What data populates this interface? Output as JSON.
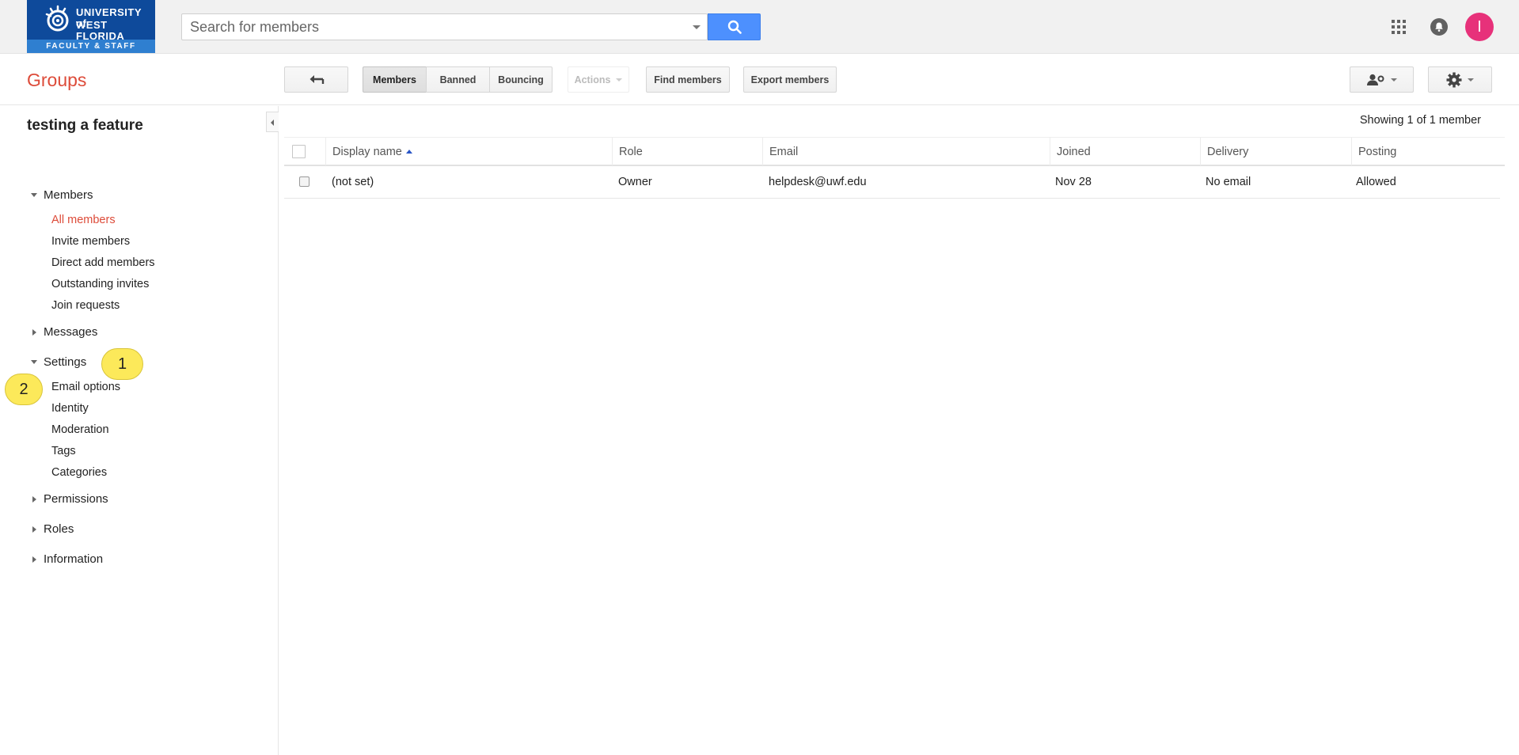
{
  "topbar": {
    "logo": {
      "line1": "UNIVERSITY of",
      "line2": "WEST FLORIDA",
      "band": "FACULTY & STAFF"
    },
    "search": {
      "placeholder": "Search for members",
      "value": ""
    },
    "icons": {
      "search": "search-icon",
      "apps": "apps-grid-icon",
      "notifications": "bell-icon"
    },
    "avatar_initial": "I",
    "avatar_color": "#e7317a"
  },
  "header": {
    "app_title": "Groups",
    "back_icon": "back-arrow-icon",
    "tabs": [
      "Members",
      "Banned",
      "Bouncing"
    ],
    "active_tab": "Members",
    "actions_label": "Actions",
    "find_members": "Find members",
    "export_members": "Export members",
    "add_member_icon": "person-gear-icon",
    "settings_icon": "gear-icon"
  },
  "sidebar": {
    "group_name": "testing a feature",
    "sections": [
      {
        "label": "Members",
        "expanded": true,
        "items": [
          "All members",
          "Invite members",
          "Direct add members",
          "Outstanding invites",
          "Join requests"
        ],
        "active_item": "All members"
      },
      {
        "label": "Messages",
        "expanded": false
      },
      {
        "label": "Settings",
        "expanded": true,
        "items": [
          "Email options",
          "Identity",
          "Moderation",
          "Tags",
          "Categories"
        ]
      },
      {
        "label": "Permissions",
        "expanded": false
      },
      {
        "label": "Roles",
        "expanded": false
      },
      {
        "label": "Information",
        "expanded": false
      }
    ],
    "callouts": [
      "1",
      "2"
    ],
    "callout_color": "#fce95a"
  },
  "main": {
    "showing": "Showing 1 of 1 member",
    "columns": [
      "Display name",
      "Role",
      "Email",
      "Joined",
      "Delivery",
      "Posting"
    ],
    "rows": [
      {
        "display_name": "(not set)",
        "role": "Owner",
        "email": "helpdesk@uwf.edu",
        "joined": "Nov 28",
        "delivery": "No email",
        "posting": "Allowed"
      }
    ]
  },
  "colors": {
    "accent": "#dd4b39",
    "search_button": "#4d90fe",
    "logo_blue": "#0e4a9b"
  }
}
